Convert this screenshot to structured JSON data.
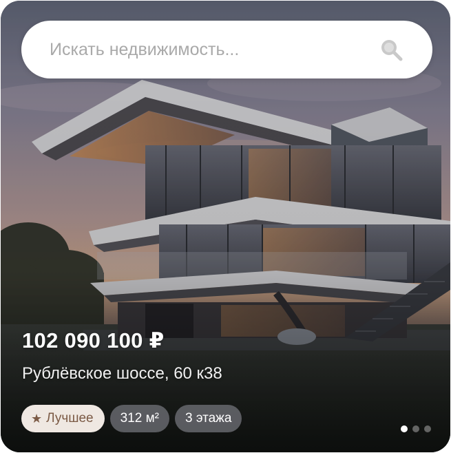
{
  "search": {
    "placeholder": "Искать недвижимость...",
    "icon": "search-icon"
  },
  "listing": {
    "price": "102 090 100 ₽",
    "address": "Рублёвское шоссе, 60 к38",
    "tags": {
      "best": {
        "label": "Лучшее",
        "icon": "star-icon"
      },
      "area": "312 м²",
      "floors": "3 этажа"
    }
  },
  "carousel": {
    "total_slides": 3,
    "active_slide": 1
  },
  "colors": {
    "tag_best_bg": "#efe8e2",
    "tag_best_text": "#7b5a45",
    "tag_dark_bg": "#6e7076",
    "text_light": "#ffffff"
  }
}
